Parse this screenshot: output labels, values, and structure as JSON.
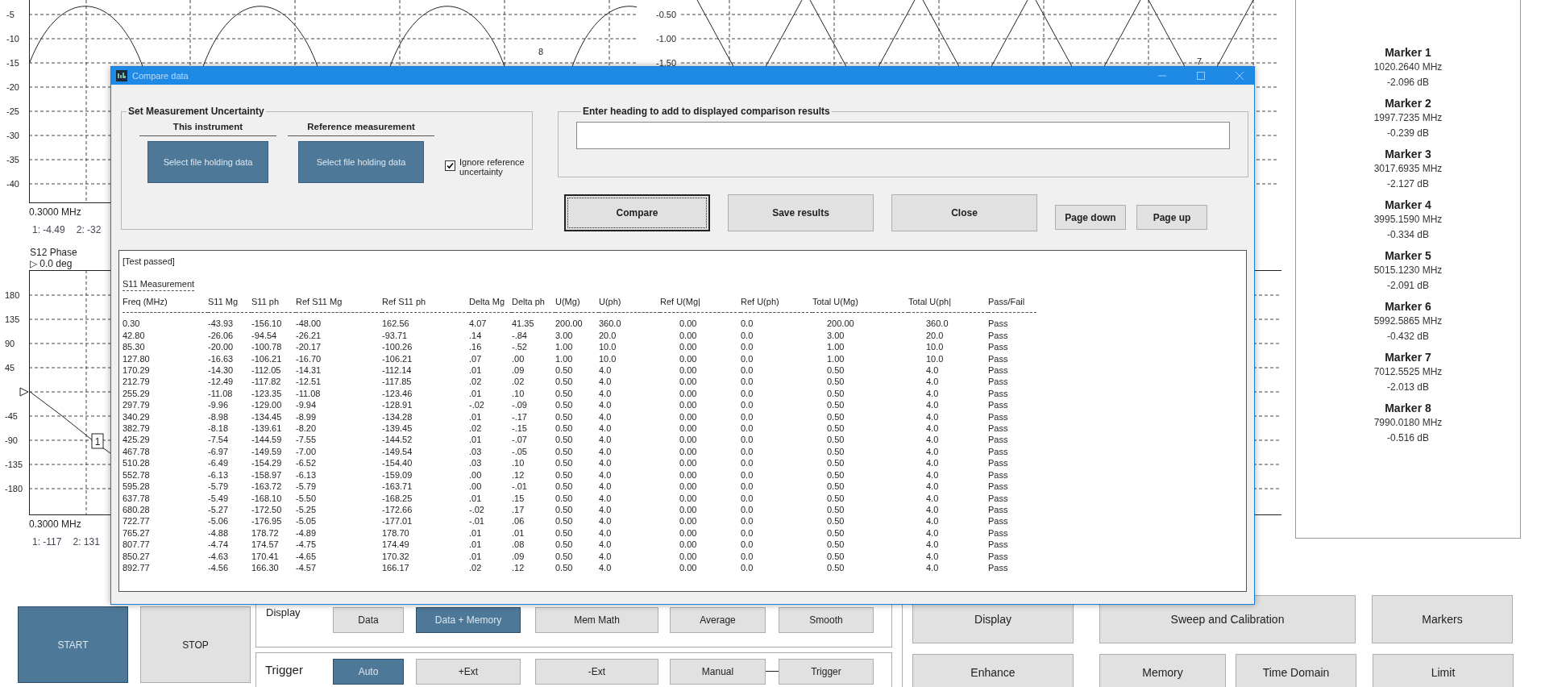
{
  "upper_left_plot": {
    "y_ticks": [
      "-5",
      "-10",
      "-15",
      "-20",
      "-25",
      "-30",
      "-35",
      "-40"
    ],
    "marker_label": "8",
    "x_start": "0.3000 MHz",
    "readouts": [
      "1: -4.49",
      "2: -32"
    ]
  },
  "upper_right_plot": {
    "y_ticks": [
      "-0.50",
      "-1.00",
      "-1.50"
    ],
    "marker_label": "7"
  },
  "phase_plot": {
    "title": "S12 Phase",
    "reference": "▷ 0.0 deg",
    "upper_ticks": [
      "180",
      "135",
      "90",
      "45"
    ],
    "lower_ticks": [
      "-45",
      "-90",
      "-135",
      "-180"
    ],
    "marker_box": "1",
    "x_start": "0.3000 MHz",
    "readouts": [
      "1: -117",
      "2: 131"
    ]
  },
  "markers": [
    {
      "name": "Marker 1",
      "frequency": "1020.2640 MHz",
      "value": "-2.096 dB"
    },
    {
      "name": "Marker 2",
      "frequency": "1997.7235 MHz",
      "value": "-0.239 dB"
    },
    {
      "name": "Marker 3",
      "frequency": "3017.6935 MHz",
      "value": "-2.127 dB"
    },
    {
      "name": "Marker 4",
      "frequency": "3995.1590 MHz",
      "value": "-0.334 dB"
    },
    {
      "name": "Marker 5",
      "frequency": "5015.1230 MHz",
      "value": "-2.091 dB"
    },
    {
      "name": "Marker 6",
      "frequency": "5992.5865 MHz",
      "value": "-0.432 dB"
    },
    {
      "name": "Marker 7",
      "frequency": "7012.5525 MHz",
      "value": "-2.013 dB"
    },
    {
      "name": "Marker 8",
      "frequency": "7990.0180 MHz",
      "value": "-0.516 dB"
    }
  ],
  "run_buttons": [
    {
      "label": "START",
      "selected": true
    },
    {
      "label": "STOP",
      "selected": false
    }
  ],
  "display_group": {
    "label": "Display",
    "buttons": [
      {
        "label": "Data",
        "selected": false
      },
      {
        "label": "Data + Memory",
        "selected": true
      },
      {
        "label": "Mem Math",
        "selected": false
      },
      {
        "label": "Average",
        "selected": false
      },
      {
        "label": "Smooth",
        "selected": false
      }
    ]
  },
  "trigger_group": {
    "label": "Trigger",
    "buttons": [
      {
        "label": "Auto",
        "selected": true,
        "linked": false
      },
      {
        "label": "+Ext",
        "selected": false,
        "linked": false
      },
      {
        "label": "-Ext",
        "selected": false,
        "linked": false
      },
      {
        "label": "Manual",
        "selected": false,
        "linked": false
      },
      {
        "label": "Trigger",
        "selected": false,
        "linked": true
      }
    ]
  },
  "menu_buttons": [
    [
      "Display",
      "Sweep and Calibration",
      "Markers"
    ],
    [
      "Enhance",
      "Memory",
      "Time Domain",
      "Limit"
    ]
  ],
  "dialog": {
    "title": "Compare data",
    "uncertainty_group": {
      "title": "Set Measurement Uncertainty",
      "sources": [
        {
          "heading": "This instrument",
          "button": "Select file holding data"
        },
        {
          "heading": "Reference measurement",
          "button": "Select file holding data"
        }
      ],
      "ignore_checkbox": {
        "label": "Ignore reference uncertainty",
        "checked": true
      }
    },
    "heading_group": {
      "title": "Enter heading to add to displayed comparison results"
    },
    "actions": [
      {
        "label": "Compare",
        "focused": true
      },
      {
        "label": "Save results",
        "focused": false
      },
      {
        "label": "Close",
        "focused": false
      }
    ],
    "paging": [
      "Page down",
      "Page up"
    ],
    "results": {
      "status": "[Test passed]",
      "section": "S11 Measurement",
      "columns": [
        "Freq (MHz)",
        "S11 Mg",
        "S11 ph",
        "Ref S11 Mg",
        "Ref S11 ph",
        "Delta Mg",
        "Delta ph",
        "U(Mg)",
        "U(ph)",
        "Ref U(Mg|",
        "Ref U(ph)",
        "Total U(Mg)",
        "Total U(ph|",
        "Pass/Fail"
      ],
      "rows": [
        [
          "0.30",
          "-43.93",
          "-156.10",
          "-48.00",
          "162.56",
          "4.07",
          "41.35",
          "200.00",
          "360.0",
          "0.00",
          "0.0",
          "200.00",
          "360.0",
          "Pass"
        ],
        [
          "42.80",
          "-26.06",
          "-94.54",
          "-26.21",
          "-93.71",
          ".14",
          "-.84",
          "3.00",
          "20.0",
          "0.00",
          "0.0",
          "3.00",
          "20.0",
          "Pass"
        ],
        [
          "85.30",
          "-20.00",
          "-100.78",
          "-20.17",
          "-100.26",
          ".16",
          "-.52",
          "1.00",
          "10.0",
          "0.00",
          "0.0",
          "1.00",
          "10.0",
          "Pass"
        ],
        [
          "127.80",
          "-16.63",
          "-106.21",
          "-16.70",
          "-106.21",
          ".07",
          ".00",
          "1.00",
          "10.0",
          "0.00",
          "0.0",
          "1.00",
          "10.0",
          "Pass"
        ],
        [
          "170.29",
          "-14.30",
          "-112.05",
          "-14.31",
          "-112.14",
          ".01",
          ".09",
          "0.50",
          "4.0",
          "0.00",
          "0.0",
          "0.50",
          "4.0",
          "Pass"
        ],
        [
          "212.79",
          "-12.49",
          "-117.82",
          "-12.51",
          "-117.85",
          ".02",
          ".02",
          "0.50",
          "4.0",
          "0.00",
          "0.0",
          "0.50",
          "4.0",
          "Pass"
        ],
        [
          "255.29",
          "-11.08",
          "-123.35",
          "-11.08",
          "-123.46",
          ".01",
          ".10",
          "0.50",
          "4.0",
          "0.00",
          "0.0",
          "0.50",
          "4.0",
          "Pass"
        ],
        [
          "297.79",
          "-9.96",
          "-129.00",
          "-9.94",
          "-128.91",
          "-.02",
          "-.09",
          "0.50",
          "4.0",
          "0.00",
          "0.0",
          "0.50",
          "4.0",
          "Pass"
        ],
        [
          "340.29",
          "-8.98",
          "-134.45",
          "-8.99",
          "-134.28",
          ".01",
          "-.17",
          "0.50",
          "4.0",
          "0.00",
          "0.0",
          "0.50",
          "4.0",
          "Pass"
        ],
        [
          "382.79",
          "-8.18",
          "-139.61",
          "-8.20",
          "-139.45",
          ".02",
          "-.15",
          "0.50",
          "4.0",
          "0.00",
          "0.0",
          "0.50",
          "4.0",
          "Pass"
        ],
        [
          "425.29",
          "-7.54",
          "-144.59",
          "-7.55",
          "-144.52",
          ".01",
          "-.07",
          "0.50",
          "4.0",
          "0.00",
          "0.0",
          "0.50",
          "4.0",
          "Pass"
        ],
        [
          "467.78",
          "-6.97",
          "-149.59",
          "-7.00",
          "-149.54",
          ".03",
          "-.05",
          "0.50",
          "4.0",
          "0.00",
          "0.0",
          "0.50",
          "4.0",
          "Pass"
        ],
        [
          "510.28",
          "-6.49",
          "-154.29",
          "-6.52",
          "-154.40",
          ".03",
          ".10",
          "0.50",
          "4.0",
          "0.00",
          "0.0",
          "0.50",
          "4.0",
          "Pass"
        ],
        [
          "552.78",
          "-6.13",
          "-158.97",
          "-6.13",
          "-159.09",
          ".00",
          ".12",
          "0.50",
          "4.0",
          "0.00",
          "0.0",
          "0.50",
          "4.0",
          "Pass"
        ],
        [
          "595.28",
          "-5.79",
          "-163.72",
          "-5.79",
          "-163.71",
          ".00",
          "-.01",
          "0.50",
          "4.0",
          "0.00",
          "0.0",
          "0.50",
          "4.0",
          "Pass"
        ],
        [
          "637.78",
          "-5.49",
          "-168.10",
          "-5.50",
          "-168.25",
          ".01",
          ".15",
          "0.50",
          "4.0",
          "0.00",
          "0.0",
          "0.50",
          "4.0",
          "Pass"
        ],
        [
          "680.28",
          "-5.27",
          "-172.50",
          "-5.25",
          "-172.66",
          "-.02",
          ".17",
          "0.50",
          "4.0",
          "0.00",
          "0.0",
          "0.50",
          "4.0",
          "Pass"
        ],
        [
          "722.77",
          "-5.06",
          "-176.95",
          "-5.05",
          "-177.01",
          "-.01",
          ".06",
          "0.50",
          "4.0",
          "0.00",
          "0.0",
          "0.50",
          "4.0",
          "Pass"
        ],
        [
          "765.27",
          "-4.88",
          "178.72",
          "-4.89",
          "178.70",
          ".01",
          ".01",
          "0.50",
          "4.0",
          "0.00",
          "0.0",
          "0.50",
          "4.0",
          "Pass"
        ],
        [
          "807.77",
          "-4.74",
          "174.57",
          "-4.75",
          "174.49",
          ".01",
          ".08",
          "0.50",
          "4.0",
          "0.00",
          "0.0",
          "0.50",
          "4.0",
          "Pass"
        ],
        [
          "850.27",
          "-4.63",
          "170.41",
          "-4.65",
          "170.32",
          ".01",
          ".09",
          "0.50",
          "4.0",
          "0.00",
          "0.0",
          "0.50",
          "4.0",
          "Pass"
        ],
        [
          "892.77",
          "-4.56",
          "166.30",
          "-4.57",
          "166.17",
          ".02",
          ".12",
          "0.50",
          "4.0",
          "0.00",
          "0.0",
          "0.50",
          "4.0",
          "Pass"
        ]
      ]
    }
  }
}
